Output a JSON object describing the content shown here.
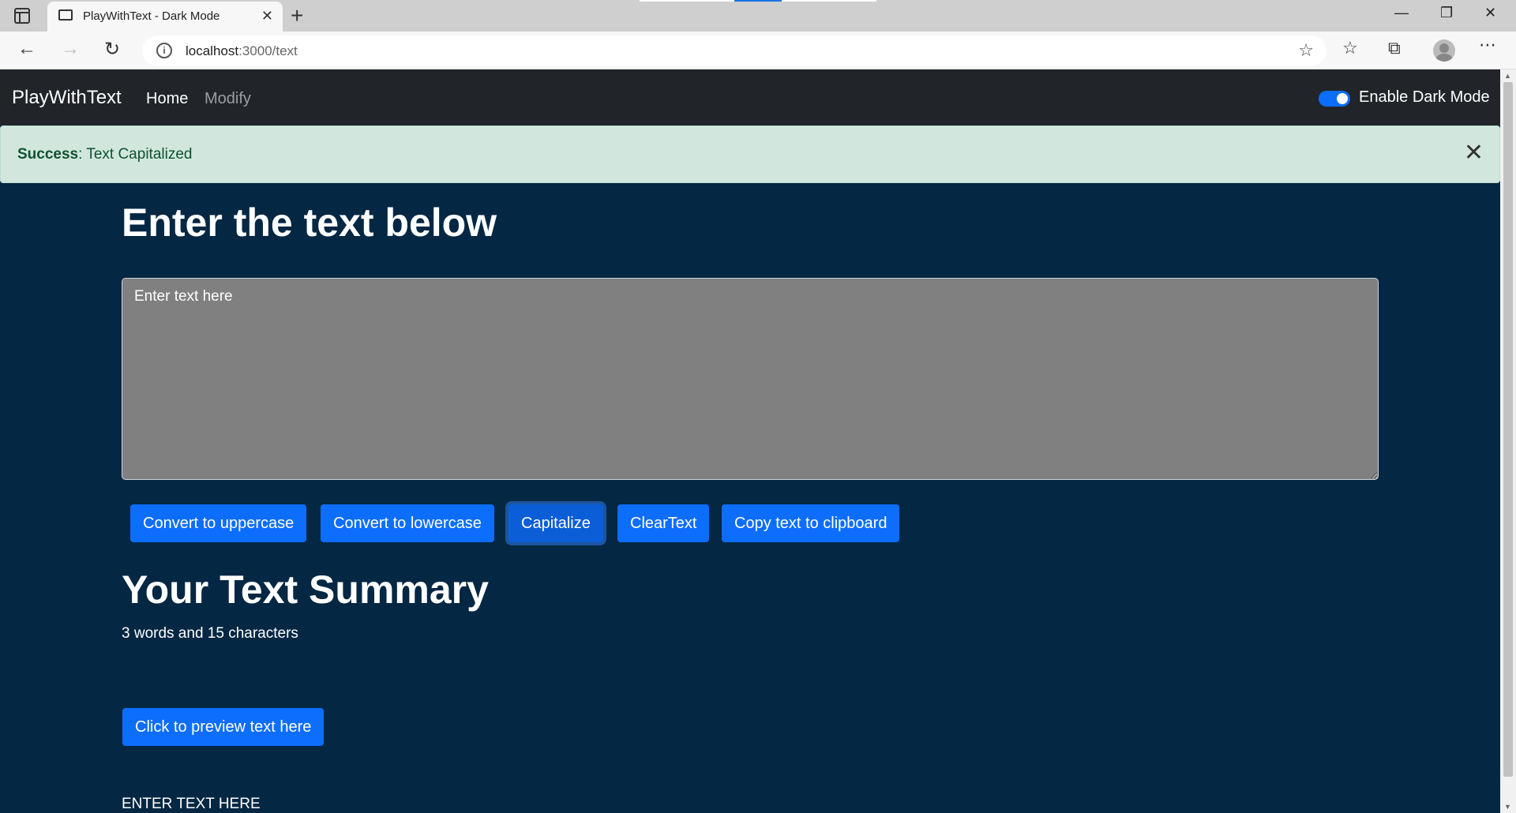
{
  "browser": {
    "tab_title": "PlayWithText - Dark Mode",
    "url_host": "localhost",
    "url_path": ":3000/text"
  },
  "navbar": {
    "brand": "PlayWithText",
    "links": [
      {
        "label": "Home",
        "active": true
      },
      {
        "label": "Modify",
        "active": false
      }
    ],
    "dark_mode_label": "Enable Dark Mode",
    "dark_mode_enabled": true
  },
  "alert": {
    "type": "Success",
    "message": ": Text Capitalized"
  },
  "main": {
    "heading": "Enter the text below",
    "textarea_placeholder": "Enter text here",
    "textarea_value": "",
    "buttons": [
      {
        "label": "Convert to uppercase"
      },
      {
        "label": "Convert to lowercase"
      },
      {
        "label": "Capitalize"
      },
      {
        "label": "ClearText"
      },
      {
        "label": "Copy text to clipboard"
      }
    ],
    "summary_heading": "Your Text Summary",
    "summary_text": "3 words and 15 characters",
    "preview_button": "Click to preview text here",
    "preview_text": "ENTER TEXT HERE"
  },
  "colors": {
    "page_bg": "#042743",
    "navbar_bg": "#212529",
    "primary": "#0d6efd",
    "alert_bg": "#d1e7dd",
    "textarea_bg": "#808080"
  }
}
